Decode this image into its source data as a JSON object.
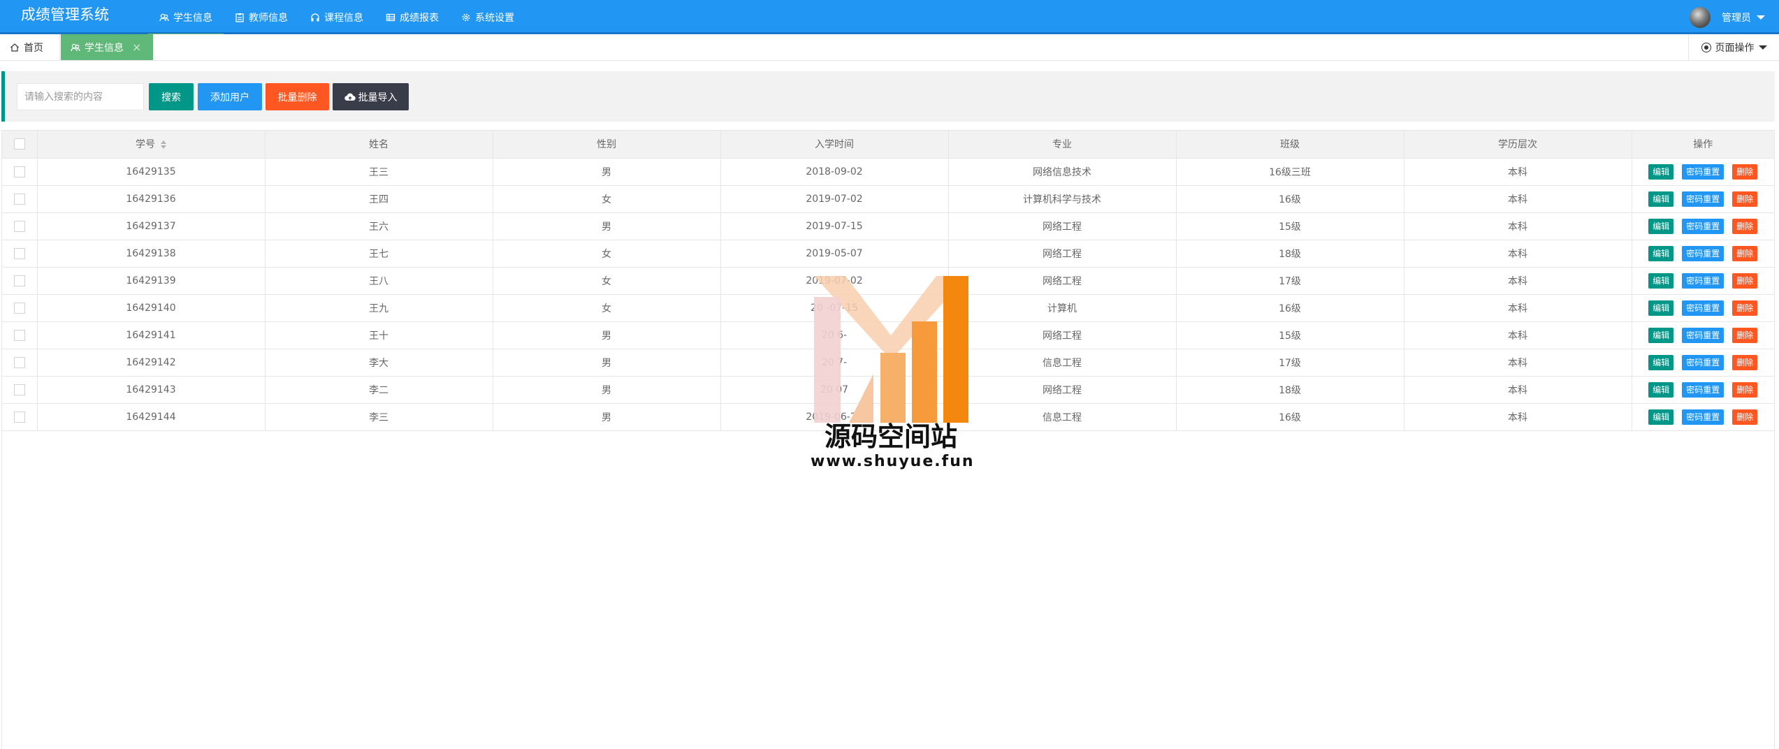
{
  "app": {
    "title": "成绩管理系统"
  },
  "nav": [
    {
      "label": "学生信息",
      "icon": "users-icon",
      "active": true
    },
    {
      "label": "教师信息",
      "icon": "clipboard-icon",
      "active": false
    },
    {
      "label": "课程信息",
      "icon": "headphones-icon",
      "active": false
    },
    {
      "label": "成绩报表",
      "icon": "table-icon",
      "active": false
    },
    {
      "label": "系统设置",
      "icon": "gear-icon",
      "active": false
    }
  ],
  "user": {
    "name": "管理员"
  },
  "tabs": [
    {
      "label": "首页"
    },
    {
      "label": "学生信息",
      "close": "×"
    }
  ],
  "page_ops": {
    "label": "页面操作"
  },
  "toolbar": {
    "search_placeholder": "请输入搜索的内容",
    "search_label": "搜索",
    "add_label": "添加用户",
    "bulk_delete_label": "批量删除",
    "bulk_import_label": "批量导入"
  },
  "table": {
    "columns": [
      "学号",
      "姓名",
      "性别",
      "入学时间",
      "专业",
      "班级",
      "学历层次",
      "操作"
    ],
    "actions": {
      "edit": "编辑",
      "reset": "密码重置",
      "delete": "删除"
    },
    "rows": [
      {
        "id": "16429135",
        "name": "王三",
        "gender": "男",
        "date": "2018-09-02",
        "major": "网络信息技术",
        "class": "16级三班",
        "level": "本科"
      },
      {
        "id": "16429136",
        "name": "王四",
        "gender": "女",
        "date": "2019-07-02",
        "major": "计算机科学与技术",
        "class": "16级",
        "level": "本科"
      },
      {
        "id": "16429137",
        "name": "王六",
        "gender": "男",
        "date": "2019-07-15",
        "major": "网络工程",
        "class": "15级",
        "level": "本科"
      },
      {
        "id": "16429138",
        "name": "王七",
        "gender": "女",
        "date": "2019-05-07",
        "major": "网络工程",
        "class": "18级",
        "level": "本科"
      },
      {
        "id": "16429139",
        "name": "王八",
        "gender": "女",
        "date": "2019-07-02",
        "major": "网络工程",
        "class": "17级",
        "level": "本科"
      },
      {
        "id": "16429140",
        "name": "王九",
        "gender": "女",
        "date": "20  -07-15",
        "major": "计算机",
        "class": "16级",
        "level": "本科"
      },
      {
        "id": "16429141",
        "name": "王十",
        "gender": "男",
        "date": "20  6-",
        "major": "网络工程",
        "class": "15级",
        "level": "本科"
      },
      {
        "id": "16429142",
        "name": "李大",
        "gender": "男",
        "date": "20  7-",
        "major": "信息工程",
        "class": "17级",
        "level": "本科"
      },
      {
        "id": "16429143",
        "name": "李二",
        "gender": "男",
        "date": "20  07",
        "major": "网络工程",
        "class": "18级",
        "level": "本科"
      },
      {
        "id": "16429144",
        "name": "李三",
        "gender": "男",
        "date": "2019-06-29",
        "major": "信息工程",
        "class": "16级",
        "level": "本科"
      }
    ]
  },
  "watermark": {
    "text": "源码空间站",
    "url": "www.shuyue.fun"
  }
}
